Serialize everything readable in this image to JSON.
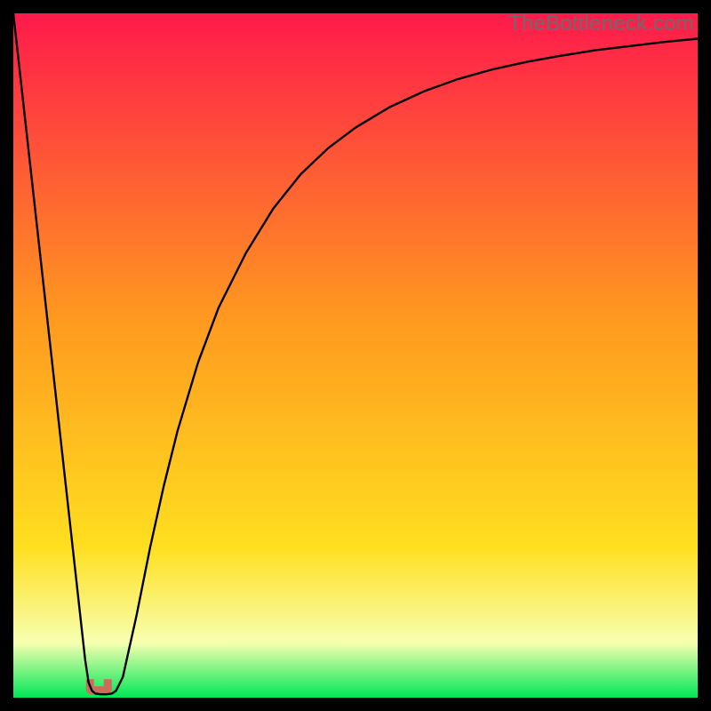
{
  "watermark": "TheBottleneck.com",
  "chart_data": {
    "type": "line",
    "title": "",
    "xlabel": "",
    "ylabel": "",
    "xlim": [
      0,
      100
    ],
    "ylim": [
      0,
      100
    ],
    "grid": false,
    "legend": false,
    "background_gradient": {
      "top_color": "#ff1a4b",
      "mid_color": "#ffdf1f",
      "near_bottom_color": "#f7ffb0",
      "bottom_color": "#00e756"
    },
    "series": [
      {
        "name": "bottleneck-curve",
        "color": "#000000",
        "x": [
          0.0,
          2.0,
          4.0,
          6.0,
          8.0,
          9.5,
          10.5,
          11.0,
          11.5,
          12.0,
          12.8,
          13.6,
          14.4,
          15.0,
          16.0,
          18.0,
          20.0,
          22.0,
          24.0,
          27.0,
          30.0,
          34.0,
          38.0,
          42.0,
          46.0,
          50.0,
          55.0,
          60.0,
          65.0,
          70.0,
          75.0,
          80.0,
          85.0,
          90.0,
          95.0,
          100.0
        ],
        "y": [
          100.0,
          82.0,
          64.0,
          46.0,
          28.0,
          14.5,
          5.5,
          2.2,
          1.0,
          0.6,
          0.5,
          0.5,
          0.6,
          1.0,
          3.0,
          12.0,
          22.0,
          31.0,
          39.0,
          49.0,
          57.0,
          65.0,
          71.5,
          76.5,
          80.3,
          83.3,
          86.3,
          88.6,
          90.4,
          91.8,
          92.9,
          93.8,
          94.6,
          95.2,
          95.8,
          96.3
        ]
      },
      {
        "name": "lowpoint-marker",
        "type": "marker",
        "center_x": 12.5,
        "center_y": 1.0,
        "width": 3.5,
        "color": "#cf6a5c"
      }
    ]
  }
}
